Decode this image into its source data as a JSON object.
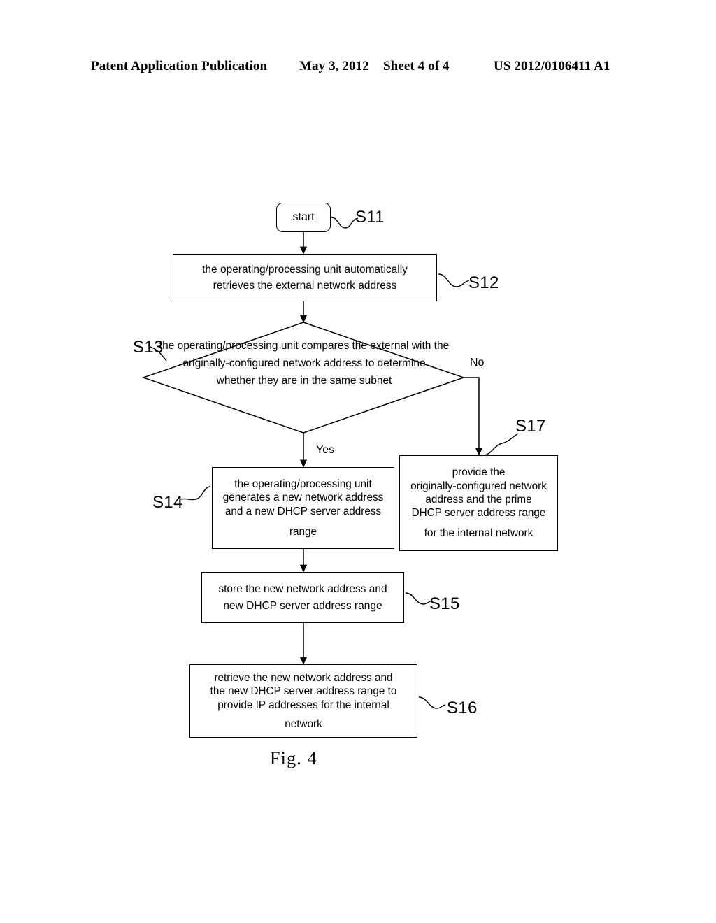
{
  "header": {
    "publication": "Patent Application Publication",
    "date": "May 3, 2012",
    "sheet": "Sheet 4 of 4",
    "patent_number": "US 2012/0106411 A1"
  },
  "figure": {
    "caption": "Fig. 4",
    "type": "flowchart"
  },
  "flowchart": {
    "nodes": {
      "start": {
        "shape": "terminator",
        "label": "start",
        "step": "S11"
      },
      "s12": {
        "shape": "process",
        "step": "S12",
        "lines": [
          "the operating/processing unit  automatically",
          "retrieves the external network address"
        ]
      },
      "s13": {
        "shape": "decision",
        "step": "S13",
        "lines": [
          "the operating/processing",
          "unit  compares the external with the",
          "originally-configured network  address to  determine",
          "whether they are in the same",
          "subnet"
        ]
      },
      "s14": {
        "shape": "process",
        "step": "S14",
        "lines": [
          "the operating/processing unit",
          "generates a new network address",
          "and a new DHCP server address",
          "range"
        ]
      },
      "s15": {
        "shape": "process",
        "step": "S15",
        "lines": [
          "store the new network address and",
          "new DHCP server address range"
        ]
      },
      "s16": {
        "shape": "process",
        "step": "S16",
        "lines": [
          "retrieve the new network address and",
          "the new DHCP server address range to",
          "provide IP addresses for the internal",
          "network"
        ]
      },
      "s17": {
        "shape": "process",
        "step": "S17",
        "lines": [
          "provide the",
          "originally-configured network",
          "address and the prime",
          "DHCP server address range",
          "for the internal network"
        ]
      }
    },
    "branches": {
      "yes": "Yes",
      "no": "No"
    },
    "edges": [
      {
        "from": "start",
        "to": "s12",
        "label": ""
      },
      {
        "from": "s12",
        "to": "s13",
        "label": ""
      },
      {
        "from": "s13",
        "to": "s14",
        "label": "Yes"
      },
      {
        "from": "s13",
        "to": "s17",
        "label": "No"
      },
      {
        "from": "s14",
        "to": "s15",
        "label": ""
      },
      {
        "from": "s15",
        "to": "s16",
        "label": ""
      }
    ]
  },
  "colors": {
    "ink": "#000000",
    "paper": "#ffffff"
  }
}
